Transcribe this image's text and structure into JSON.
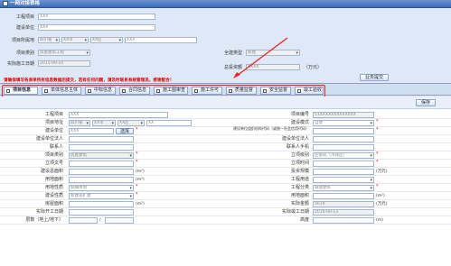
{
  "window": {
    "title": "一网对接表格"
  },
  "top_form": {
    "project_name": {
      "label": "工程项目",
      "value": "XXX"
    },
    "build_unit": {
      "label": "建设单位",
      "value": "XXX"
    },
    "location": {
      "label": "项目所属地",
      "province": "四川省",
      "city": "XX市",
      "district": "XX区",
      "detail": "XXX"
    },
    "project_category": {
      "label": "项目类别",
      "value": "房屋建筑工程"
    },
    "total_investment": {
      "label": "总投资额",
      "value": "XXXX",
      "unit": "（万元）"
    },
    "plan_start_date": {
      "label": "实际施工日期",
      "value": "2015-09-10"
    },
    "building_category": {
      "label": "全建类型",
      "value": "新建"
    },
    "submit_label": "业务提交",
    "warning": "请确保填写各表单所有信息数据后提交，若有任何问题，请及时联系系统管理员，感谢配合！"
  },
  "tabs": [
    {
      "label": "项目信息",
      "checked": false
    },
    {
      "label": "单体信息主体",
      "checked": false
    },
    {
      "label": "中标信息",
      "checked": false
    },
    {
      "label": "合同信息",
      "checked": false
    },
    {
      "label": "施工图审查",
      "checked": false
    },
    {
      "label": "施工许可",
      "checked": false
    },
    {
      "label": "质量监督",
      "checked": false
    },
    {
      "label": "安全监督",
      "checked": false
    },
    {
      "label": "竣工验收",
      "checked": false
    }
  ],
  "toolbar": {
    "save_label": "保存"
  },
  "grid": {
    "rows": [
      {
        "l1": "工程项目",
        "v1": "XXX",
        "l2": "项目编号",
        "v2": "51XXXXXXXXXXXXX"
      },
      {
        "l1": "项目地址",
        "v1a": "四川省",
        "v1b": "XX市",
        "v1c": "XX区",
        "v1d": "XX",
        "l2": "建设模式",
        "v2": "自建"
      },
      {
        "l1": "建设单位",
        "v1": "XXX",
        "select_label": "选择",
        "l2": "建设单位组织机构代码（或统一社会信用代码）",
        "v2": ""
      },
      {
        "l1": "建设单位法人",
        "v1": "",
        "l2": "建设单位法人",
        "v2": ""
      },
      {
        "l1": "联系人",
        "v1": "",
        "l2": "联系人手机",
        "v2": ""
      },
      {
        "l1": "项目类别",
        "v1": "房屋建筑",
        "l2": "立项级别",
        "v2": "区级或（市辖区）"
      },
      {
        "l1": "立项文号",
        "v1": "",
        "l2": "立项时间",
        "v2": ""
      },
      {
        "l1": "建设总面积",
        "v1": "",
        "v1_unit": "(m²)",
        "l2": "投资规模",
        "v2": "",
        "v2_unit": "(万元)"
      },
      {
        "l1": "用地面积",
        "v1": "",
        "v1_unit": "(m²)",
        "l2": "工程用途",
        "v2": ""
      },
      {
        "l1": "用地性质",
        "v1": "城镇用地",
        "l2": "工程分类",
        "v2": "城建建筑"
      },
      {
        "l1": "建设性质",
        "v1": "新建或扩建",
        "l2": "用地面积",
        "v2": "",
        "v2_unit": "(m²)"
      },
      {
        "l1": "房屋面积",
        "v1": "",
        "v1_unit": "(m²)",
        "l2": "实际金额",
        "v2": "5619",
        "v2_unit": "(万元)"
      },
      {
        "l1": "实际开工日期",
        "v1": "",
        "l2": "实际竣工日期",
        "v2": "2016-09-13"
      },
      {
        "l1": "层数（地上/地下）",
        "v1": "",
        "sep": "/",
        "l2": "高度",
        "v2": "",
        "v2_unit": "(m)"
      }
    ]
  }
}
